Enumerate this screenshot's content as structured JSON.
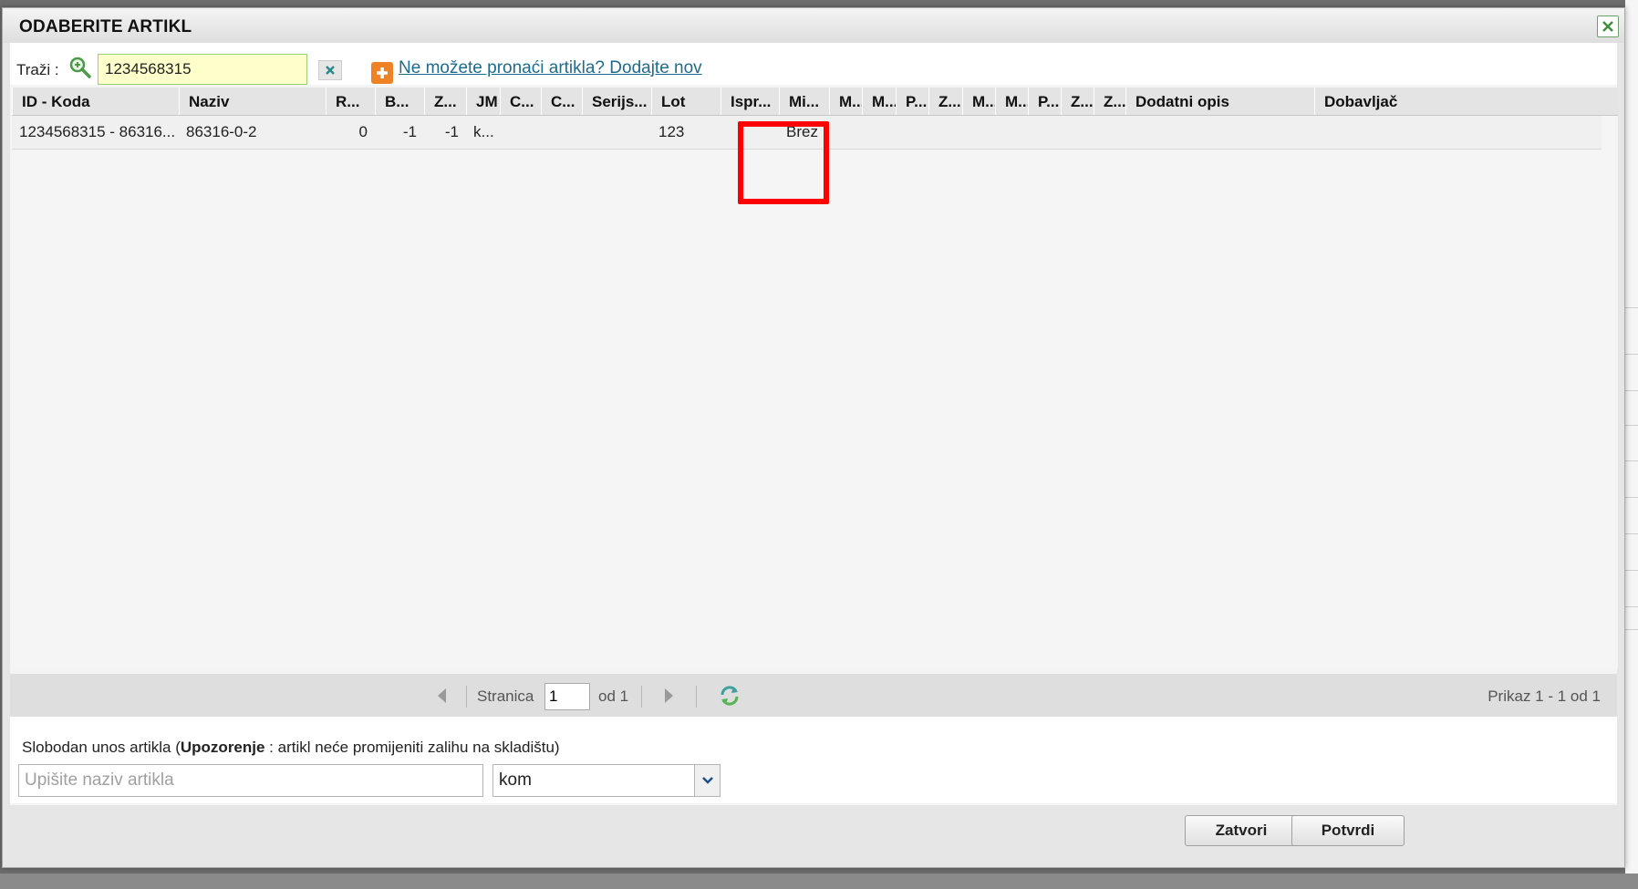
{
  "dialog": {
    "title": "ODABERITE ARTIKL"
  },
  "search": {
    "label": "Traži :",
    "value": "1234568315",
    "add_link": "Ne možete pronaći artikla? Dodajte nov"
  },
  "grid": {
    "columns": [
      "ID - Koda",
      "Naziv",
      "R...",
      "B...",
      "Z...",
      "JM",
      "C...",
      "C...",
      "Serijs...",
      "Lot",
      "Ispr...",
      "Mi...",
      "M...",
      "M...",
      "P...",
      "Z...",
      "M...",
      "M...",
      "P...",
      "Z...",
      "Z...",
      "Dodatni opis",
      "Dobavljač"
    ],
    "rows": [
      [
        "1234568315 - 86316...",
        "86316-0-2",
        "0",
        "-1",
        "-1",
        "k...",
        "",
        "",
        "",
        "123",
        "",
        "Brez",
        "",
        "",
        "",
        "",
        "",
        "",
        "",
        "",
        "",
        "",
        ""
      ]
    ],
    "highlighted_column": "Lot"
  },
  "pager": {
    "page_label": "Stranica",
    "page_value": "1",
    "of_label": "od 1",
    "info": "Prikaz 1 - 1 od 1"
  },
  "free_entry": {
    "label_prefix": "Slobodan unos artikla (",
    "label_bold": "Upozorenje",
    "label_suffix": " : artikl neće promijeniti zalihu na skladištu)",
    "placeholder": "Upišite naziv artikla",
    "unit_value": "kom"
  },
  "buttons": {
    "close": "Zatvori",
    "confirm": "Potvrdi"
  },
  "colors": {
    "highlight": "#ff0000",
    "search_bg": "#ffffcc",
    "link": "#1d6b8f",
    "add_icon": "#f08226"
  }
}
